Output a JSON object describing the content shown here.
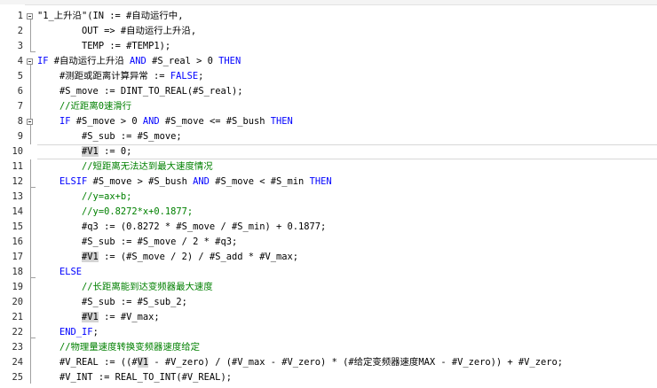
{
  "editor": {
    "lines": [
      {
        "n": "1",
        "segs": [
          [
            "n",
            "\"1_上升沿\"(IN := #自动运行中,"
          ]
        ]
      },
      {
        "n": "2",
        "segs": [
          [
            "n",
            "        OUT => #自动运行上升沿,"
          ]
        ]
      },
      {
        "n": "3",
        "segs": [
          [
            "n",
            "        TEMP := #TEMP1);"
          ]
        ]
      },
      {
        "n": "4",
        "segs": [
          [
            "k",
            "IF"
          ],
          [
            "n",
            " #自动运行上升沿 "
          ],
          [
            "k",
            "AND"
          ],
          [
            "n",
            " #S_real > "
          ],
          [
            "n",
            "0"
          ],
          [
            "n",
            " "
          ],
          [
            "k",
            "THEN"
          ]
        ]
      },
      {
        "n": "5",
        "segs": [
          [
            "n",
            "    #测距或距离计算异常 := "
          ],
          [
            "k",
            "FALSE"
          ],
          [
            "n",
            ";"
          ]
        ]
      },
      {
        "n": "6",
        "segs": [
          [
            "n",
            "    #S_move := "
          ],
          [
            "n",
            "DINT_TO_REAL(#S_real);"
          ]
        ]
      },
      {
        "n": "7",
        "segs": [
          [
            "c",
            "    //近距离0速滑行"
          ]
        ]
      },
      {
        "n": "8",
        "segs": [
          [
            "n",
            "    "
          ],
          [
            "k",
            "IF"
          ],
          [
            "n",
            " #S_move > 0 "
          ],
          [
            "k",
            "AND"
          ],
          [
            "n",
            " #S_move <= #S_bush "
          ],
          [
            "k",
            "THEN"
          ]
        ]
      },
      {
        "n": "9",
        "segs": [
          [
            "n",
            "        #S_sub := #S_move;"
          ]
        ]
      },
      {
        "n": "10",
        "segs": [
          [
            "n",
            "        "
          ],
          [
            "hl",
            "#V1"
          ],
          [
            "n",
            " := 0;"
          ]
        ],
        "current": true
      },
      {
        "n": "11",
        "segs": [
          [
            "c",
            "        //短距离无法达到最大速度情况"
          ]
        ]
      },
      {
        "n": "12",
        "segs": [
          [
            "n",
            "    "
          ],
          [
            "k",
            "ELSIF"
          ],
          [
            "n",
            " #S_move > #S_bush "
          ],
          [
            "k",
            "AND"
          ],
          [
            "n",
            " #S_move < #S_min "
          ],
          [
            "k",
            "THEN"
          ]
        ]
      },
      {
        "n": "13",
        "segs": [
          [
            "c",
            "        //y=ax+b;"
          ]
        ]
      },
      {
        "n": "14",
        "segs": [
          [
            "c",
            "        //y=0.8272*x+0.1877;"
          ]
        ]
      },
      {
        "n": "15",
        "segs": [
          [
            "n",
            "        #q3 := (0.8272 * #S_move / #S_min) + 0.1877;"
          ]
        ]
      },
      {
        "n": "16",
        "segs": [
          [
            "n",
            "        #S_sub := #S_move / 2 * #q3;"
          ]
        ]
      },
      {
        "n": "17",
        "segs": [
          [
            "n",
            "        "
          ],
          [
            "hl",
            "#V1"
          ],
          [
            "n",
            " := (#S_move / 2) / #S_add * #V_max;"
          ]
        ]
      },
      {
        "n": "18",
        "segs": [
          [
            "n",
            "    "
          ],
          [
            "k",
            "ELSE"
          ]
        ]
      },
      {
        "n": "19",
        "segs": [
          [
            "c",
            "        //长距离能到达变频器最大速度"
          ]
        ]
      },
      {
        "n": "20",
        "segs": [
          [
            "n",
            "        #S_sub := #S_sub_2;"
          ]
        ]
      },
      {
        "n": "21",
        "segs": [
          [
            "n",
            "        "
          ],
          [
            "hl",
            "#V1"
          ],
          [
            "n",
            " := #V_max;"
          ]
        ]
      },
      {
        "n": "22",
        "segs": [
          [
            "n",
            "    "
          ],
          [
            "k",
            "END_IF"
          ],
          [
            "n",
            ";"
          ]
        ]
      },
      {
        "n": "23",
        "segs": [
          [
            "c",
            "    //物理量速度转换变频器速度给定"
          ]
        ]
      },
      {
        "n": "24",
        "segs": [
          [
            "n",
            "    #V_REAL := ((#"
          ],
          [
            "hl",
            "V1"
          ],
          [
            "n",
            " - #V_zero) / (#V_max - #V_zero) * (#给定变频器速度MAX - #V_zero)) + #V_zero;"
          ]
        ]
      },
      {
        "n": "25",
        "segs": [
          [
            "n",
            "    #V_INT := REAL_TO_INT(#V_REAL);"
          ]
        ]
      }
    ]
  },
  "colors": {
    "keyword": "#0000ff",
    "comment": "#008000",
    "highlight": "#d4d4d4"
  }
}
